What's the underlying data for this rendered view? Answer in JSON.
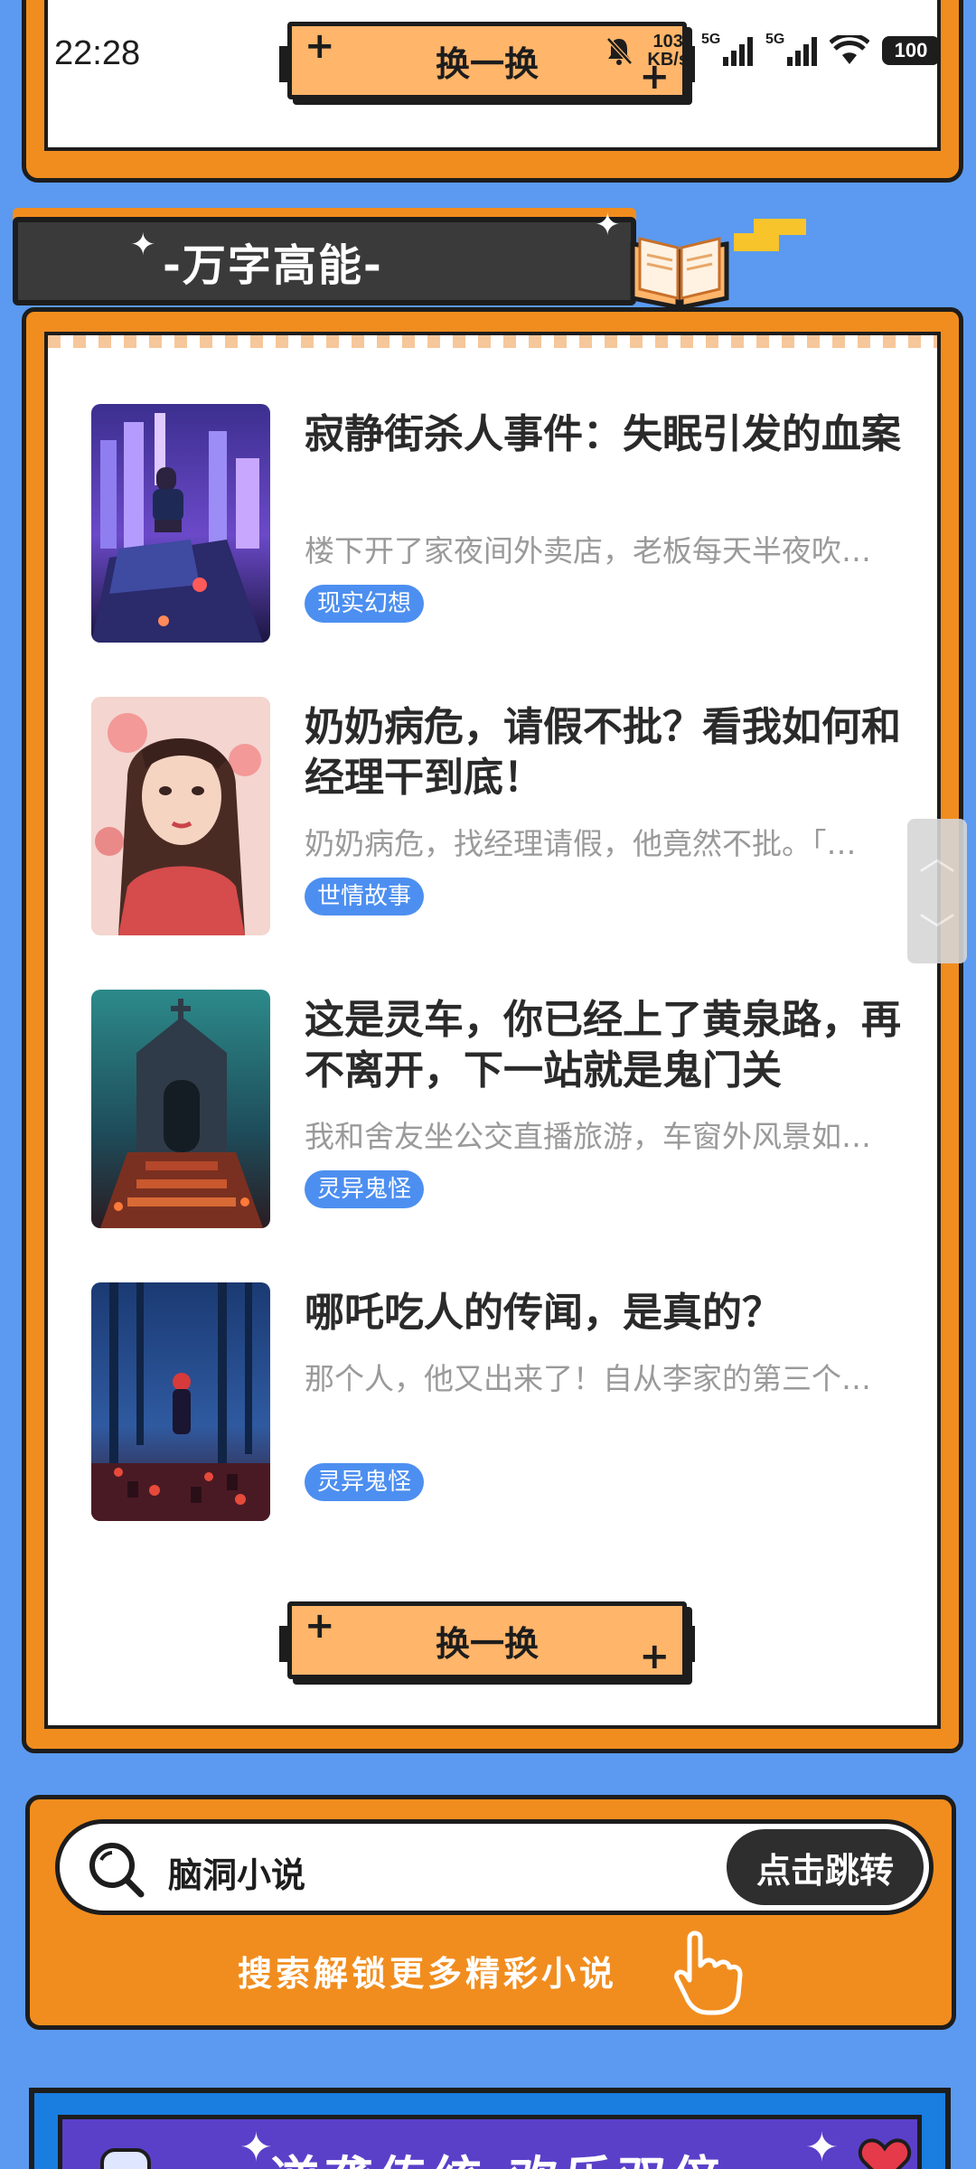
{
  "status_bar": {
    "time": "22:28",
    "net_speed_value": "103",
    "net_speed_unit": "KB/s",
    "signal_1_label": "5G",
    "signal_2_label": "5G",
    "battery": "100"
  },
  "top_section": {
    "swap_label": "换一换"
  },
  "section_header": {
    "title": "-万字高能-"
  },
  "books": [
    {
      "title": "寂静街杀人事件：失眠引发的血案",
      "desc": "楼下开了家夜间外卖店，老板每天半夜吹…",
      "tag": "现实幻想"
    },
    {
      "title": "奶奶病危，请假不批？看我如何和经理干到底！",
      "desc": "奶奶病危，找经理请假，他竟然不批。「…",
      "tag": "世情故事"
    },
    {
      "title": "这是灵车，你已经上了黄泉路，再不离开，下一站就是鬼门关",
      "desc": "我和舍友坐公交直播旅游，车窗外风景如…",
      "tag": "灵异鬼怪"
    },
    {
      "title": "哪吒吃人的传闻，是真的？",
      "desc": "那个人，他又出来了！自从李家的第三个…",
      "tag": "灵异鬼怪"
    }
  ],
  "main_section": {
    "swap_label": "换一换"
  },
  "search": {
    "query": "脑洞小说",
    "button_label": "点击跳转",
    "hint": "搜索解锁更多精彩小说"
  },
  "bottom_banner": {
    "title": "逆袭传统 欢乐双倍"
  },
  "colors": {
    "background": "#5b9af0",
    "accent_orange": "#f18d1e",
    "button_orange": "#ffb56a",
    "tag_blue": "#4d8ff0",
    "dark": "#1d1d1d"
  }
}
